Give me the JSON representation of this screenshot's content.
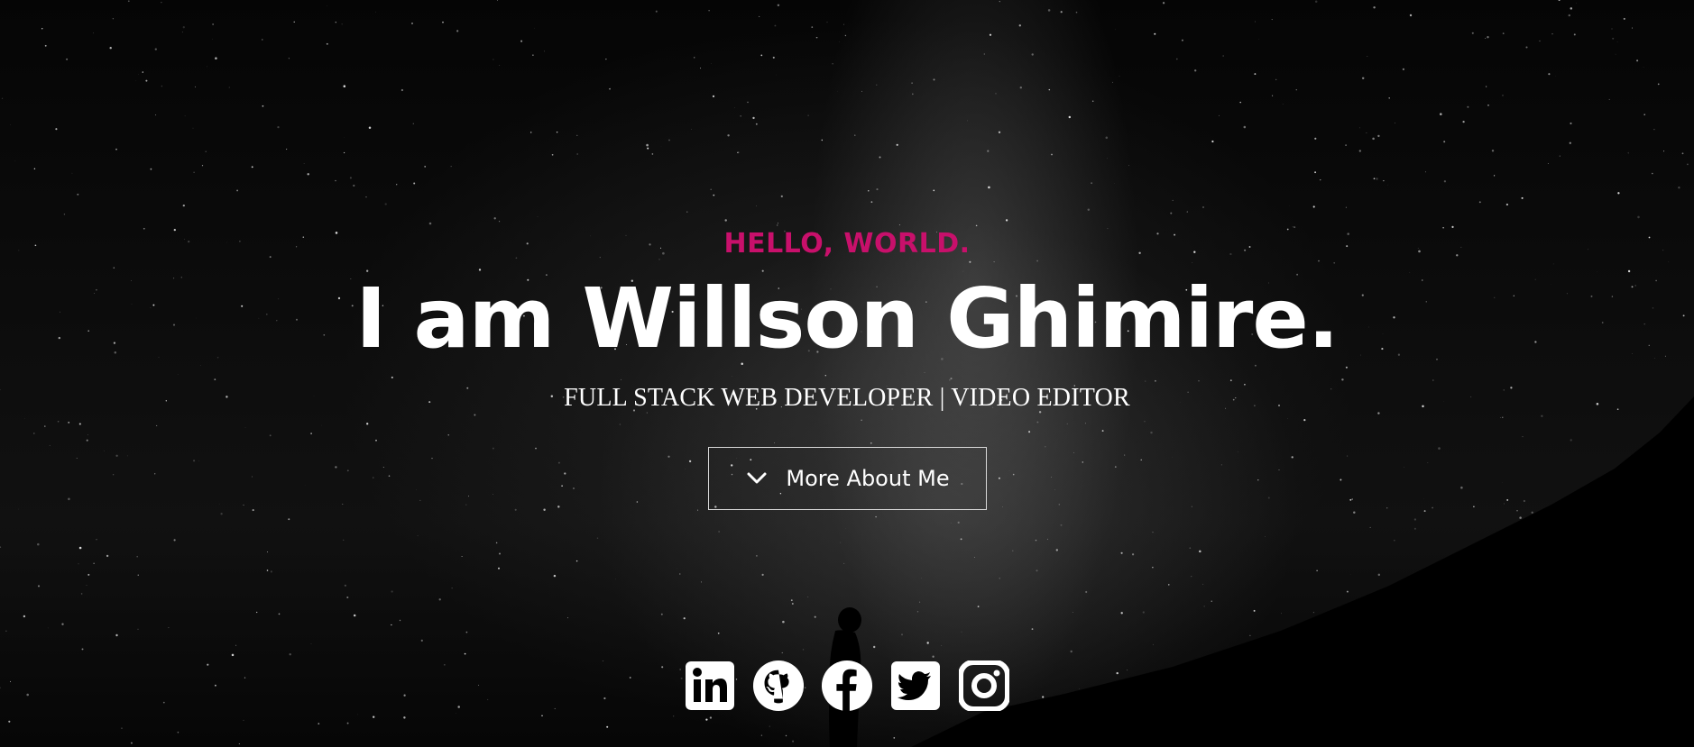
{
  "hero": {
    "greeting": "HELLO, WORLD.",
    "name": "I am Willson Ghimire.",
    "role": "FULL STACK WEB DEVELOPER | VIDEO EDITOR",
    "cta_label": "More About Me",
    "cta_icon": "chevron-down-icon"
  },
  "social_links": [
    {
      "name": "linkedin",
      "icon": "linkedin-icon"
    },
    {
      "name": "github",
      "icon": "github-icon"
    },
    {
      "name": "facebook",
      "icon": "facebook-icon"
    },
    {
      "name": "twitter",
      "icon": "twitter-icon"
    },
    {
      "name": "instagram",
      "icon": "instagram-icon"
    }
  ],
  "colors": {
    "accent": "#c8106b",
    "text": "#ffffff",
    "background": "#000000"
  }
}
